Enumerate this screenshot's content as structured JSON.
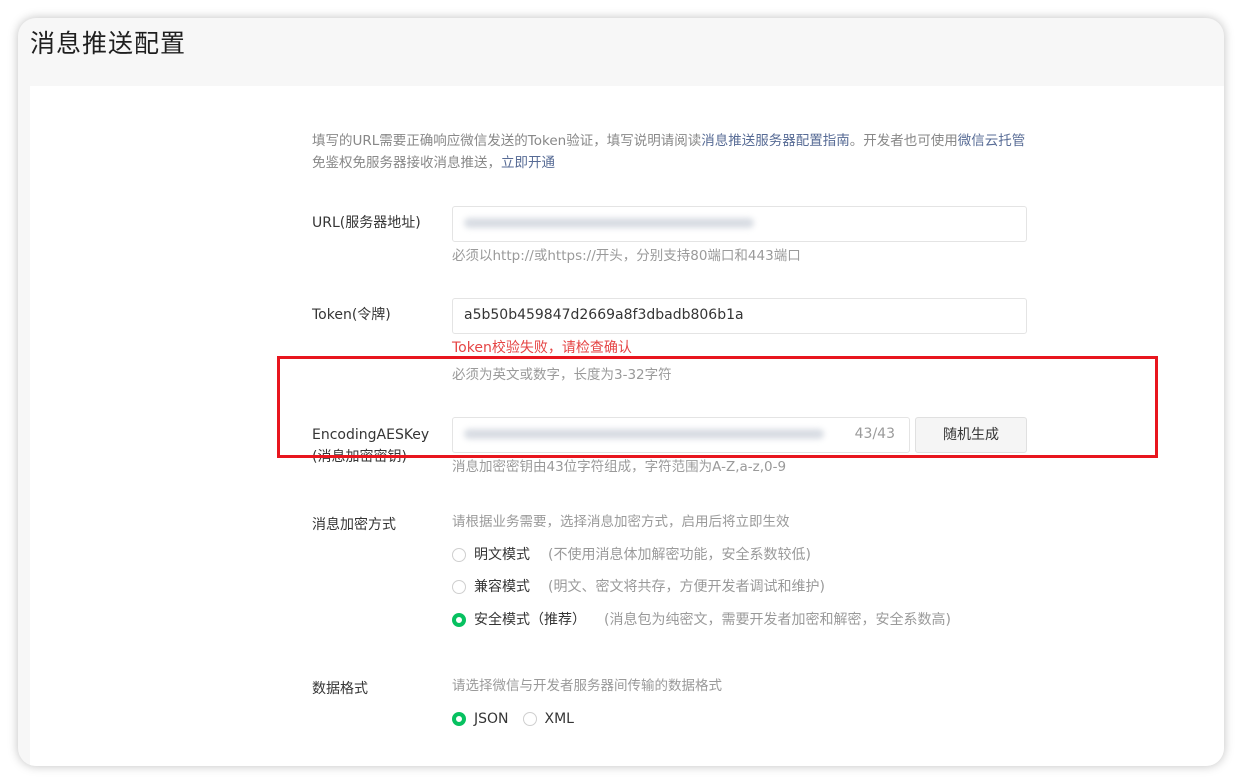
{
  "page": {
    "title": "消息推送配置"
  },
  "tip": {
    "text1": "填写的URL需要正确响应微信发送的Token验证，填写说明请阅读",
    "link1": "消息推送服务器配置指南",
    "text2": "。开发者也可使用",
    "link2": "微信云托管",
    "text3": "免鉴权免服务器接收消息推送，",
    "link3": "立即开通"
  },
  "url": {
    "label": "URL(服务器地址)",
    "hint": "必须以http://或https://开头，分别支持80端口和443端口"
  },
  "token": {
    "label": "Token(令牌)",
    "value": "a5b50b459847d2669a8f3dbadb806b1a",
    "error": "Token校验失败，请检查确认",
    "hint": "必须为英文或数字，长度为3-32字符"
  },
  "aeskey": {
    "label_line1": "EncodingAESKey",
    "label_line2": "(消息加密密钥)",
    "counter": "43/43",
    "random_button": "随机生成",
    "hint": "消息加密密钥由43位字符组成，字符范围为A-Z,a-z,0-9"
  },
  "encryption": {
    "label": "消息加密方式",
    "hint": "请根据业务需要，选择消息加密方式，启用后将立即生效",
    "options": [
      {
        "label": "明文模式",
        "desc": "(不使用消息体加解密功能，安全系数较低)",
        "checked": false
      },
      {
        "label": "兼容模式",
        "desc": "(明文、密文将共存，方便开发者调试和维护)",
        "checked": false
      },
      {
        "label": "安全模式（推荐）",
        "desc": "(消息包为纯密文，需要开发者加密和解密，安全系数高)",
        "checked": true
      }
    ]
  },
  "format": {
    "label": "数据格式",
    "hint": "请选择微信与开发者服务器间传输的数据格式",
    "options": [
      {
        "label": "JSON",
        "checked": true
      },
      {
        "label": "XML",
        "checked": false
      }
    ]
  },
  "colors": {
    "accent": "#07c160",
    "link": "#576b95",
    "error": "#e54545",
    "highlight": "#e8161e"
  }
}
